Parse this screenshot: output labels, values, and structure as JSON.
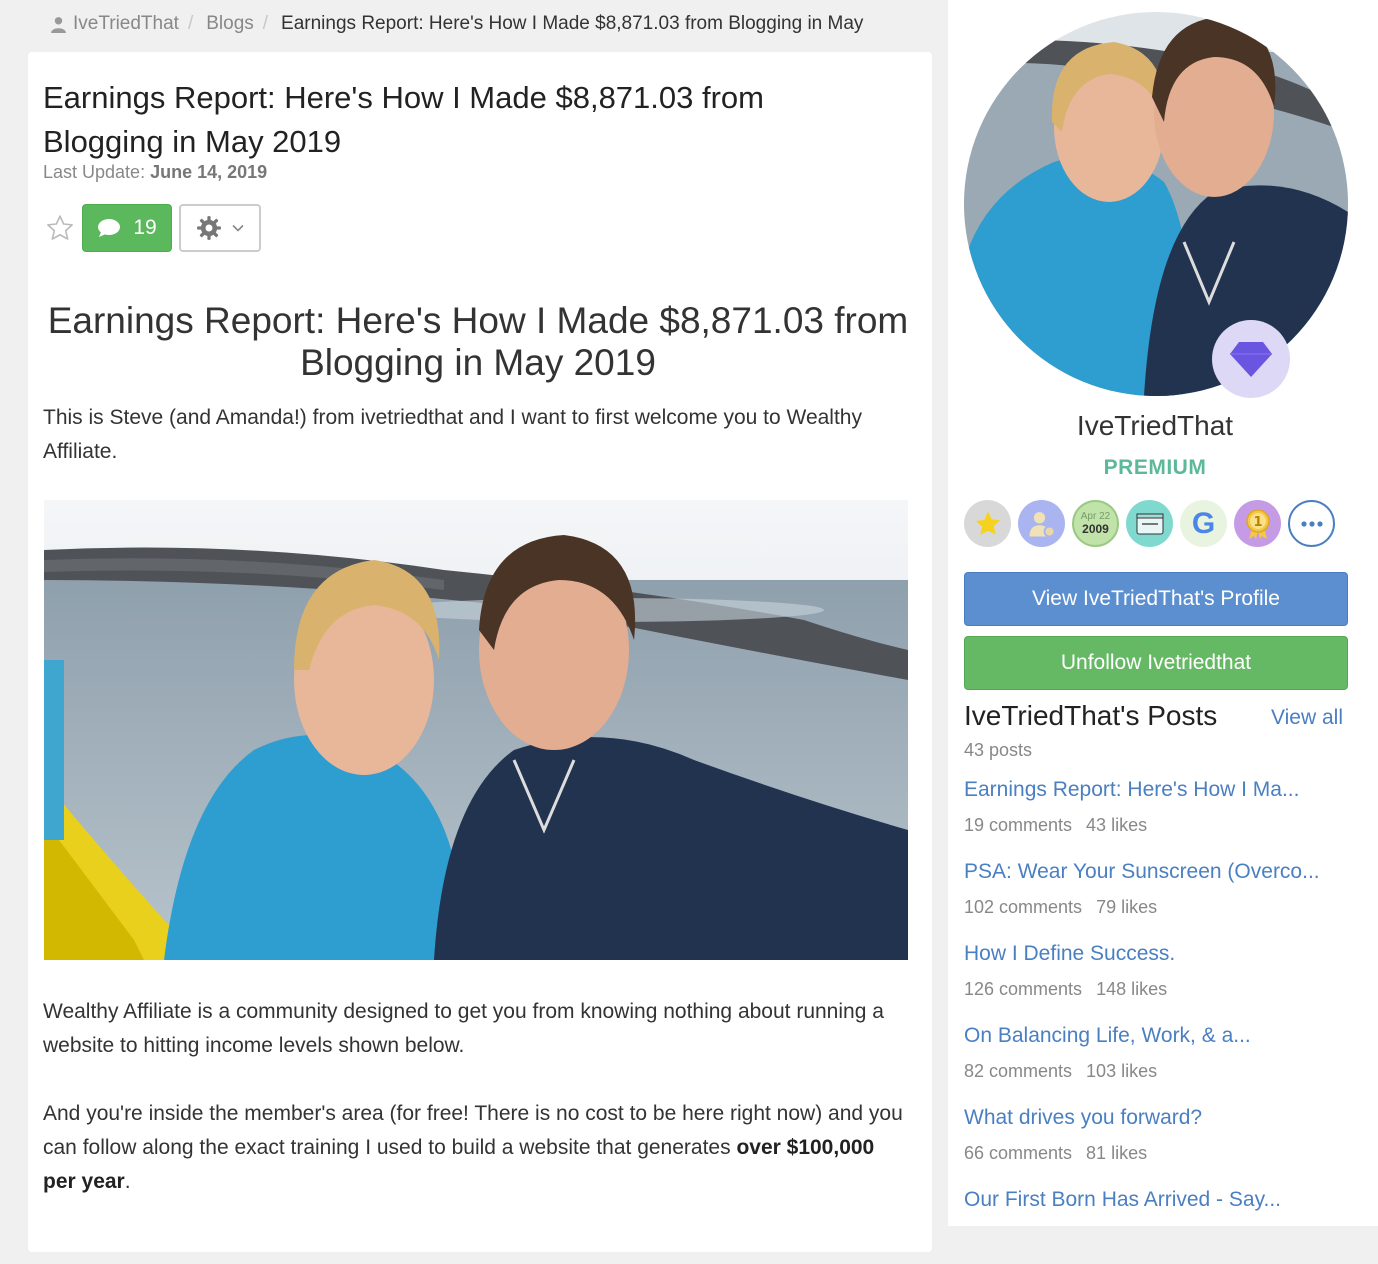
{
  "breadcrumb": {
    "home": "IveTriedThat",
    "blogs": "Blogs",
    "current": "Earnings Report: Here's How I Made $8,871.03 from Blogging in May"
  },
  "post": {
    "title": "Earnings Report: Here's How I Made $8,871.03 from Blogging in May 2019",
    "last_update_label": "Last Update:",
    "last_update_date": "June 14, 2019",
    "comment_count": "19",
    "article_heading": "Earnings Report: Here's How I Made $8,871.03 from Blogging in May 2019",
    "intro": "This is Steve (and Amanda!) from ivetriedthat and I want to first welcome you to Wealthy Affiliate.",
    "para2": "Wealthy Affiliate is a community designed to get you from knowing nothing about running a website to hitting income levels shown below.",
    "para3_start": "And you're inside the member's area (for free! There is no cost to be here right now) and you can follow along the exact training I used to build a website that generates ",
    "para3_bold": "over $100,000 per year",
    "para3_end": "."
  },
  "sidebar": {
    "username": "IveTriedThat",
    "membership": "PREMIUM",
    "badges": [
      {
        "icon": "star-badge-icon",
        "color": "#d8d8d8"
      },
      {
        "icon": "user-gear-badge-icon",
        "color": "#aab4f0"
      },
      {
        "icon": "date-badge-icon",
        "color": "#bfe3a8",
        "month": "Apr 22",
        "year": "2009"
      },
      {
        "icon": "website-badge-icon",
        "color": "#7fd9cf"
      },
      {
        "icon": "google-badge-icon",
        "color": "#e8f3e0"
      },
      {
        "icon": "rank-one-badge-icon",
        "color": "#c59be6"
      },
      {
        "icon": "more-badges-icon",
        "color": "#ffffff"
      }
    ],
    "view_profile_label": "View IveTriedThat's Profile",
    "unfollow_label": "Unfollow Ivetriedthat",
    "posts_heading": "IveTriedThat's Posts",
    "view_all": "View all",
    "post_count": "43 posts",
    "posts": [
      {
        "title": "Earnings Report: Here's How I Ma...",
        "comments": "19 comments",
        "likes": "43 likes"
      },
      {
        "title": "PSA: Wear Your Sunscreen (Overco...",
        "comments": "102 comments",
        "likes": "79 likes"
      },
      {
        "title": "How I Define Success.",
        "comments": "126 comments",
        "likes": "148 likes"
      },
      {
        "title": "On Balancing Life, Work, & a...",
        "comments": "82 comments",
        "likes": "103 likes"
      },
      {
        "title": "What drives you forward?",
        "comments": "66 comments",
        "likes": "81 likes"
      },
      {
        "title": "Our First Born Has Arrived - Say...",
        "comments": "",
        "likes": ""
      }
    ]
  },
  "colors": {
    "link": "#4a7fc1",
    "premium": "#5cb89a",
    "comments_button": "#5cb85c",
    "profile_button": "#5b8fd0",
    "unfollow_button": "#66b964",
    "diamond": "#6a55e0"
  }
}
